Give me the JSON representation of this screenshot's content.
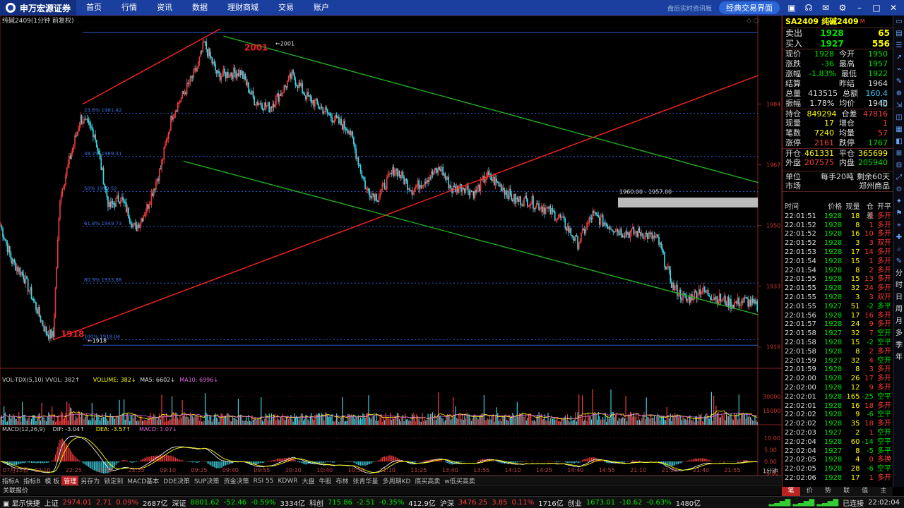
{
  "topbar": {
    "logo": "申万宏源证券",
    "nav": [
      "首页",
      "行情",
      "资讯",
      "数据",
      "理财商城",
      "交易",
      "账户"
    ],
    "mode": "经典交易界面",
    "right_text": "盘后实时资讯板"
  },
  "chart_header": {
    "title": "纯碱2409(1分钟 前复权)",
    "vol_label": "VOL-TDX(5,10) VVOL: 382↑",
    "vol_volume": "VOLUME: 382↓",
    "vol_ma5": "MA5: 6602↓",
    "vol_ma10": "MA10: 6996↓",
    "macd_label": "MACD(12,26,9)",
    "macd_dif": "DIF: -3.04↑",
    "macd_dea": "DEA: -3.57↑",
    "macd_val": "MACD: 1.07↓",
    "high_mark": "2001",
    "low_mark": "1918",
    "high_tick": "2001",
    "low_tick": "1918",
    "range_box": "1960.00 - 1957.00",
    "period": "1分钟"
  },
  "chart_data": {
    "type": "candlestick",
    "y_axis_ticks": [
      1984,
      1967,
      1950,
      1933,
      1916
    ],
    "vol_axis_ticks": [
      30000,
      15000
    ],
    "macd_axis_ticks": [
      "10.00",
      "5.00",
      "0.00",
      "-5.00"
    ],
    "x_tick_labels": [
      "07月15日",
      "22:10",
      "22:25",
      "22:40",
      "22:55",
      "09:10",
      "09:25",
      "09:40",
      "09:55",
      "10:10",
      "10:40",
      "10:55",
      "11:10",
      "11:25",
      "13:40",
      "13:55",
      "14:10",
      "14:25",
      "14:40",
      "14:55",
      "21:10",
      "21:25",
      "21:40",
      "21:55"
    ],
    "fib_levels": [
      {
        "label": "23.6% 1981.42",
        "value": 1981.42
      },
      {
        "label": "38.2% 1969.31",
        "value": 1969.31
      },
      {
        "label": "50% 1959.52",
        "value": 1959.52
      },
      {
        "label": "61.8% 1949.73",
        "value": 1949.73
      },
      {
        "label": "80.9% 1933.88",
        "value": 1933.88
      },
      {
        "label": "100% 1918.04",
        "value": 1918.04
      }
    ],
    "anchors": [
      [
        0,
        1950
      ],
      [
        10,
        1940
      ],
      [
        20,
        1936
      ],
      [
        30,
        1928
      ],
      [
        40,
        1920
      ],
      [
        46,
        1919
      ],
      [
        52,
        1958
      ],
      [
        60,
        1968
      ],
      [
        70,
        1980
      ],
      [
        82,
        1976
      ],
      [
        95,
        1955
      ],
      [
        105,
        1958
      ],
      [
        118,
        1949
      ],
      [
        128,
        1955
      ],
      [
        140,
        1966
      ],
      [
        150,
        1981
      ],
      [
        162,
        1988
      ],
      [
        172,
        1994
      ],
      [
        178,
        2001
      ],
      [
        190,
        1992
      ],
      [
        210,
        1993
      ],
      [
        222,
        1985
      ],
      [
        235,
        1983
      ],
      [
        245,
        1987
      ],
      [
        255,
        1992
      ],
      [
        268,
        1986
      ],
      [
        280,
        1983
      ],
      [
        295,
        1979
      ],
      [
        305,
        1977
      ],
      [
        320,
        1960
      ],
      [
        330,
        1958
      ],
      [
        345,
        1966
      ],
      [
        360,
        1960
      ],
      [
        372,
        1963
      ],
      [
        385,
        1966
      ],
      [
        395,
        1960
      ],
      [
        405,
        1961
      ],
      [
        415,
        1959
      ],
      [
        425,
        1964
      ],
      [
        438,
        1961
      ],
      [
        450,
        1957
      ],
      [
        462,
        1957
      ],
      [
        475,
        1955
      ],
      [
        490,
        1952
      ],
      [
        505,
        1945
      ],
      [
        518,
        1953
      ],
      [
        532,
        1950
      ],
      [
        545,
        1948
      ],
      [
        560,
        1948
      ],
      [
        575,
        1946
      ],
      [
        588,
        1933
      ],
      [
        600,
        1929
      ],
      [
        612,
        1932
      ],
      [
        625,
        1930
      ],
      [
        640,
        1928
      ],
      [
        652,
        1929
      ],
      [
        663,
        1927
      ]
    ],
    "total_bars": 663,
    "y_range": [
      1912,
      2006
    ],
    "trendlines": [
      {
        "color": "#f22",
        "from": [
          46,
          1918
        ],
        "to": [
          663,
          1992
        ]
      },
      {
        "color": "#f22",
        "from": [
          72,
          1984
        ],
        "to": [
          192,
          2005
        ]
      },
      {
        "color": "#2a2",
        "from": [
          195,
          2003
        ],
        "to": [
          663,
          1962
        ]
      },
      {
        "color": "#2a2",
        "from": [
          160,
          1968
        ],
        "to": [
          663,
          1925
        ]
      }
    ]
  },
  "quote": {
    "code": "SA2409",
    "name": "纯碱2409",
    "sell_label": "卖出",
    "sell_price": "1928",
    "sell_vol": "65",
    "buy_label": "买入",
    "buy_price": "1927",
    "buy_vol": "556",
    "rows": [
      [
        "现价",
        "1928",
        "今开",
        "1950"
      ],
      [
        "涨跌",
        "-36",
        "最高",
        "1957"
      ],
      [
        "涨幅",
        "-1.83%",
        "最低",
        "1922"
      ],
      [
        "结算",
        "",
        "昨结",
        "1964"
      ],
      [
        "总量",
        "413515",
        "总额",
        "160.4亿"
      ],
      [
        "振幅",
        "1.78%",
        "均价",
        "1940"
      ],
      [
        "持仓",
        "849294",
        "仓差",
        "47816"
      ],
      [
        "现量",
        "17",
        "增仓",
        "1"
      ],
      [
        "笔数",
        "7240",
        "均量",
        "57"
      ],
      [
        "涨停",
        "2161",
        "跌停",
        "1767"
      ],
      [
        "开仓",
        "461331",
        "平仓",
        "365699"
      ],
      [
        "外盘",
        "207575",
        "内盘",
        "205940"
      ]
    ],
    "unit_label": "单位",
    "unit_val": "每手20吨",
    "remain": "剩余60天",
    "market_label": "市场",
    "market_val": "郑州商品",
    "tick_head": [
      "时间",
      "价格",
      "现量",
      "仓差",
      "开平"
    ],
    "ticks": [
      [
        "22:01:51",
        "1928",
        "18",
        "1",
        "多开"
      ],
      [
        "22:01:52",
        "1928",
        "8",
        "1",
        "多开"
      ],
      [
        "22:01:52",
        "1928",
        "16",
        "10",
        "多开"
      ],
      [
        "22:01:52",
        "1928",
        "3",
        "3",
        "双开"
      ],
      [
        "22:01:53",
        "1928",
        "17",
        "14",
        "多开"
      ],
      [
        "22:01:54",
        "1928",
        "15",
        "1",
        "多开"
      ],
      [
        "22:01:54",
        "1928",
        "8",
        "2",
        "多开"
      ],
      [
        "22:01:55",
        "1928",
        "15",
        "13",
        "多开"
      ],
      [
        "22:01:55",
        "1928",
        "32",
        "24",
        "多开"
      ],
      [
        "22:01:55",
        "1928",
        "3",
        "3",
        "双开"
      ],
      [
        "22:01:55",
        "1927",
        "51",
        "-2",
        "多平"
      ],
      [
        "22:01:56",
        "1928",
        "17",
        "16",
        "多开"
      ],
      [
        "22:01:57",
        "1928",
        "24",
        "9",
        "多开"
      ],
      [
        "22:01:58",
        "1927",
        "32",
        "7",
        "空开"
      ],
      [
        "22:01:58",
        "1928",
        "15",
        "-2",
        "空平"
      ],
      [
        "22:01:58",
        "1928",
        "8",
        "2",
        "多开"
      ],
      [
        "22:01:59",
        "1927",
        "32",
        "4",
        "空开"
      ],
      [
        "22:01:59",
        "1928",
        "8",
        "3",
        "多开"
      ],
      [
        "22:02:00",
        "1928",
        "26",
        "17",
        "多开"
      ],
      [
        "22:02:00",
        "1928",
        "12",
        "9",
        "多开"
      ],
      [
        "22:02:01",
        "1928",
        "165",
        "-25",
        "空平"
      ],
      [
        "22:02:01",
        "1928",
        "16",
        "18",
        "多开"
      ],
      [
        "22:02:02",
        "1928",
        "9",
        "-6",
        "空平"
      ],
      [
        "22:02:02",
        "1928",
        "35",
        "18",
        "多开"
      ],
      [
        "22:02:03",
        "1927",
        "2",
        "1",
        "空开"
      ],
      [
        "22:02:04",
        "1928",
        "60",
        "-14",
        "空平"
      ],
      [
        "22:02:04",
        "1927",
        "8",
        "-5",
        "多平"
      ],
      [
        "22:02:05",
        "1928",
        "4",
        "0",
        "多换"
      ],
      [
        "22:02:05",
        "1928",
        "28",
        "-6",
        "空平"
      ],
      [
        "22:02:06",
        "1928",
        "17",
        "1",
        "多开"
      ]
    ]
  },
  "bottom_tabs": [
    "指标A",
    "指标B",
    "模 板",
    "管理",
    "另存为",
    "锁定到",
    "MACD基本",
    "DDE决策",
    "SUP决策",
    "资金决策",
    "RSI 55",
    "KDWR",
    "大盘",
    "牛股",
    "布林",
    "张青华量",
    "多周期KD",
    "底买高卖",
    "w低买高卖"
  ],
  "news": "关联报价",
  "right_tabs": [
    "笔",
    "价",
    "势",
    "联",
    "值",
    "主"
  ],
  "status": {
    "brand": "显示快捷",
    "items": [
      [
        "上证",
        "2974.01",
        "2.71",
        "0.09%",
        "2687亿"
      ],
      [
        "深证",
        "8801.62",
        "-52.46",
        "-0.59%",
        "3334亿"
      ],
      [
        "科创",
        "715.86",
        "-2.51",
        "-0.35%",
        "412.9亿"
      ],
      [
        "沪深",
        "3476.25",
        "3.85",
        "0.11%",
        "1716亿"
      ],
      [
        "创业",
        "1673.01",
        "-10.62",
        "-0.63%",
        "1480亿"
      ]
    ],
    "conn": "已连接",
    "time": "22:02:04"
  },
  "sidetools": [
    "分",
    "时",
    "日",
    "周",
    "月",
    "多",
    "季",
    "年"
  ]
}
